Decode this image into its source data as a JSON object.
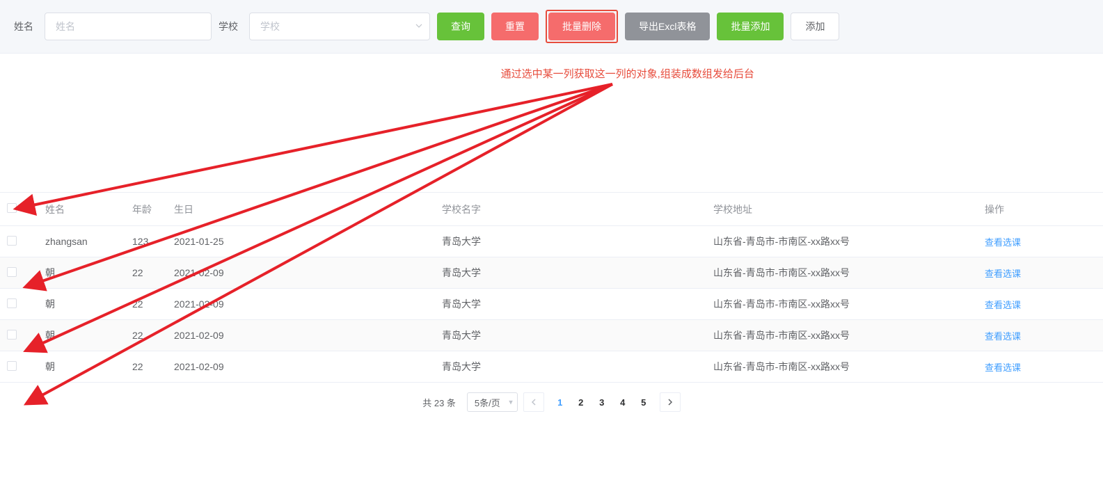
{
  "toolbar": {
    "name_label": "姓名",
    "name_placeholder": "姓名",
    "school_label": "学校",
    "school_placeholder": "学校",
    "buttons": {
      "query": "查询",
      "reset": "重置",
      "batch_delete": "批量删除",
      "export_excel": "导出Excl表格",
      "batch_add": "批量添加",
      "add": "添加"
    }
  },
  "annotation": "通过选中某一列获取这一列的对象,组装成数组发给后台",
  "table": {
    "headers": {
      "name": "姓名",
      "age": "年龄",
      "birthday": "生日",
      "school_name": "学校名字",
      "school_addr": "学校地址",
      "operate": "操作"
    },
    "op_link": "查看选课",
    "rows": [
      {
        "name": "zhangsan",
        "age": "123",
        "birthday": "2021-01-25",
        "school": "青岛大学",
        "addr": "山东省-青岛市-市南区-xx路xx号"
      },
      {
        "name": "朝",
        "age": "22",
        "birthday": "2021-02-09",
        "school": "青岛大学",
        "addr": "山东省-青岛市-市南区-xx路xx号"
      },
      {
        "name": "朝",
        "age": "22",
        "birthday": "2021-02-09",
        "school": "青岛大学",
        "addr": "山东省-青岛市-市南区-xx路xx号"
      },
      {
        "name": "朝",
        "age": "22",
        "birthday": "2021-02-09",
        "school": "青岛大学",
        "addr": "山东省-青岛市-市南区-xx路xx号"
      },
      {
        "name": "朝",
        "age": "22",
        "birthday": "2021-02-09",
        "school": "青岛大学",
        "addr": "山东省-青岛市-市南区-xx路xx号"
      }
    ]
  },
  "pagination": {
    "total_text": "共 23 条",
    "page_size_label": "5条/页",
    "pages": [
      "1",
      "2",
      "3",
      "4",
      "5"
    ],
    "current": 1
  }
}
